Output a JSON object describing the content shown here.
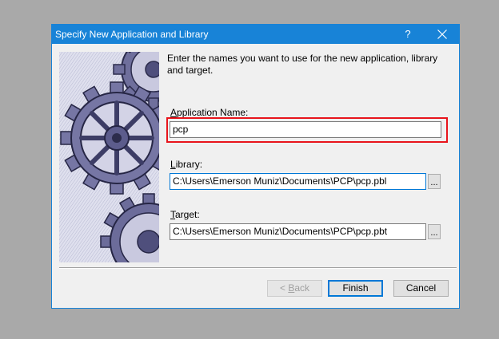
{
  "window": {
    "title": "Specify New Application and Library",
    "help": "?"
  },
  "intro_text": "Enter the names you want to use for the new application, library and target.",
  "application_name": {
    "label_pre": "",
    "label_mnemonic": "A",
    "label_post": "pplication Name:",
    "value": "pcp"
  },
  "library": {
    "label_mnemonic": "L",
    "label_post": "ibrary:",
    "value": "C:\\Users\\Emerson Muniz\\Documents\\PCP\\pcp.pbl",
    "browse": "..."
  },
  "target": {
    "label_mnemonic": "T",
    "label_post": "arget:",
    "value": "C:\\Users\\Emerson Muniz\\Documents\\PCP\\pcp.pbt",
    "browse": "..."
  },
  "buttons": {
    "back_pre": "< ",
    "back_mnemonic": "B",
    "back_post": "ack",
    "finish": "Finish",
    "cancel": "Cancel"
  },
  "colors": {
    "titlebar": "#1883d7",
    "highlight": "#e8141b",
    "gears": "#5a5a8a"
  }
}
